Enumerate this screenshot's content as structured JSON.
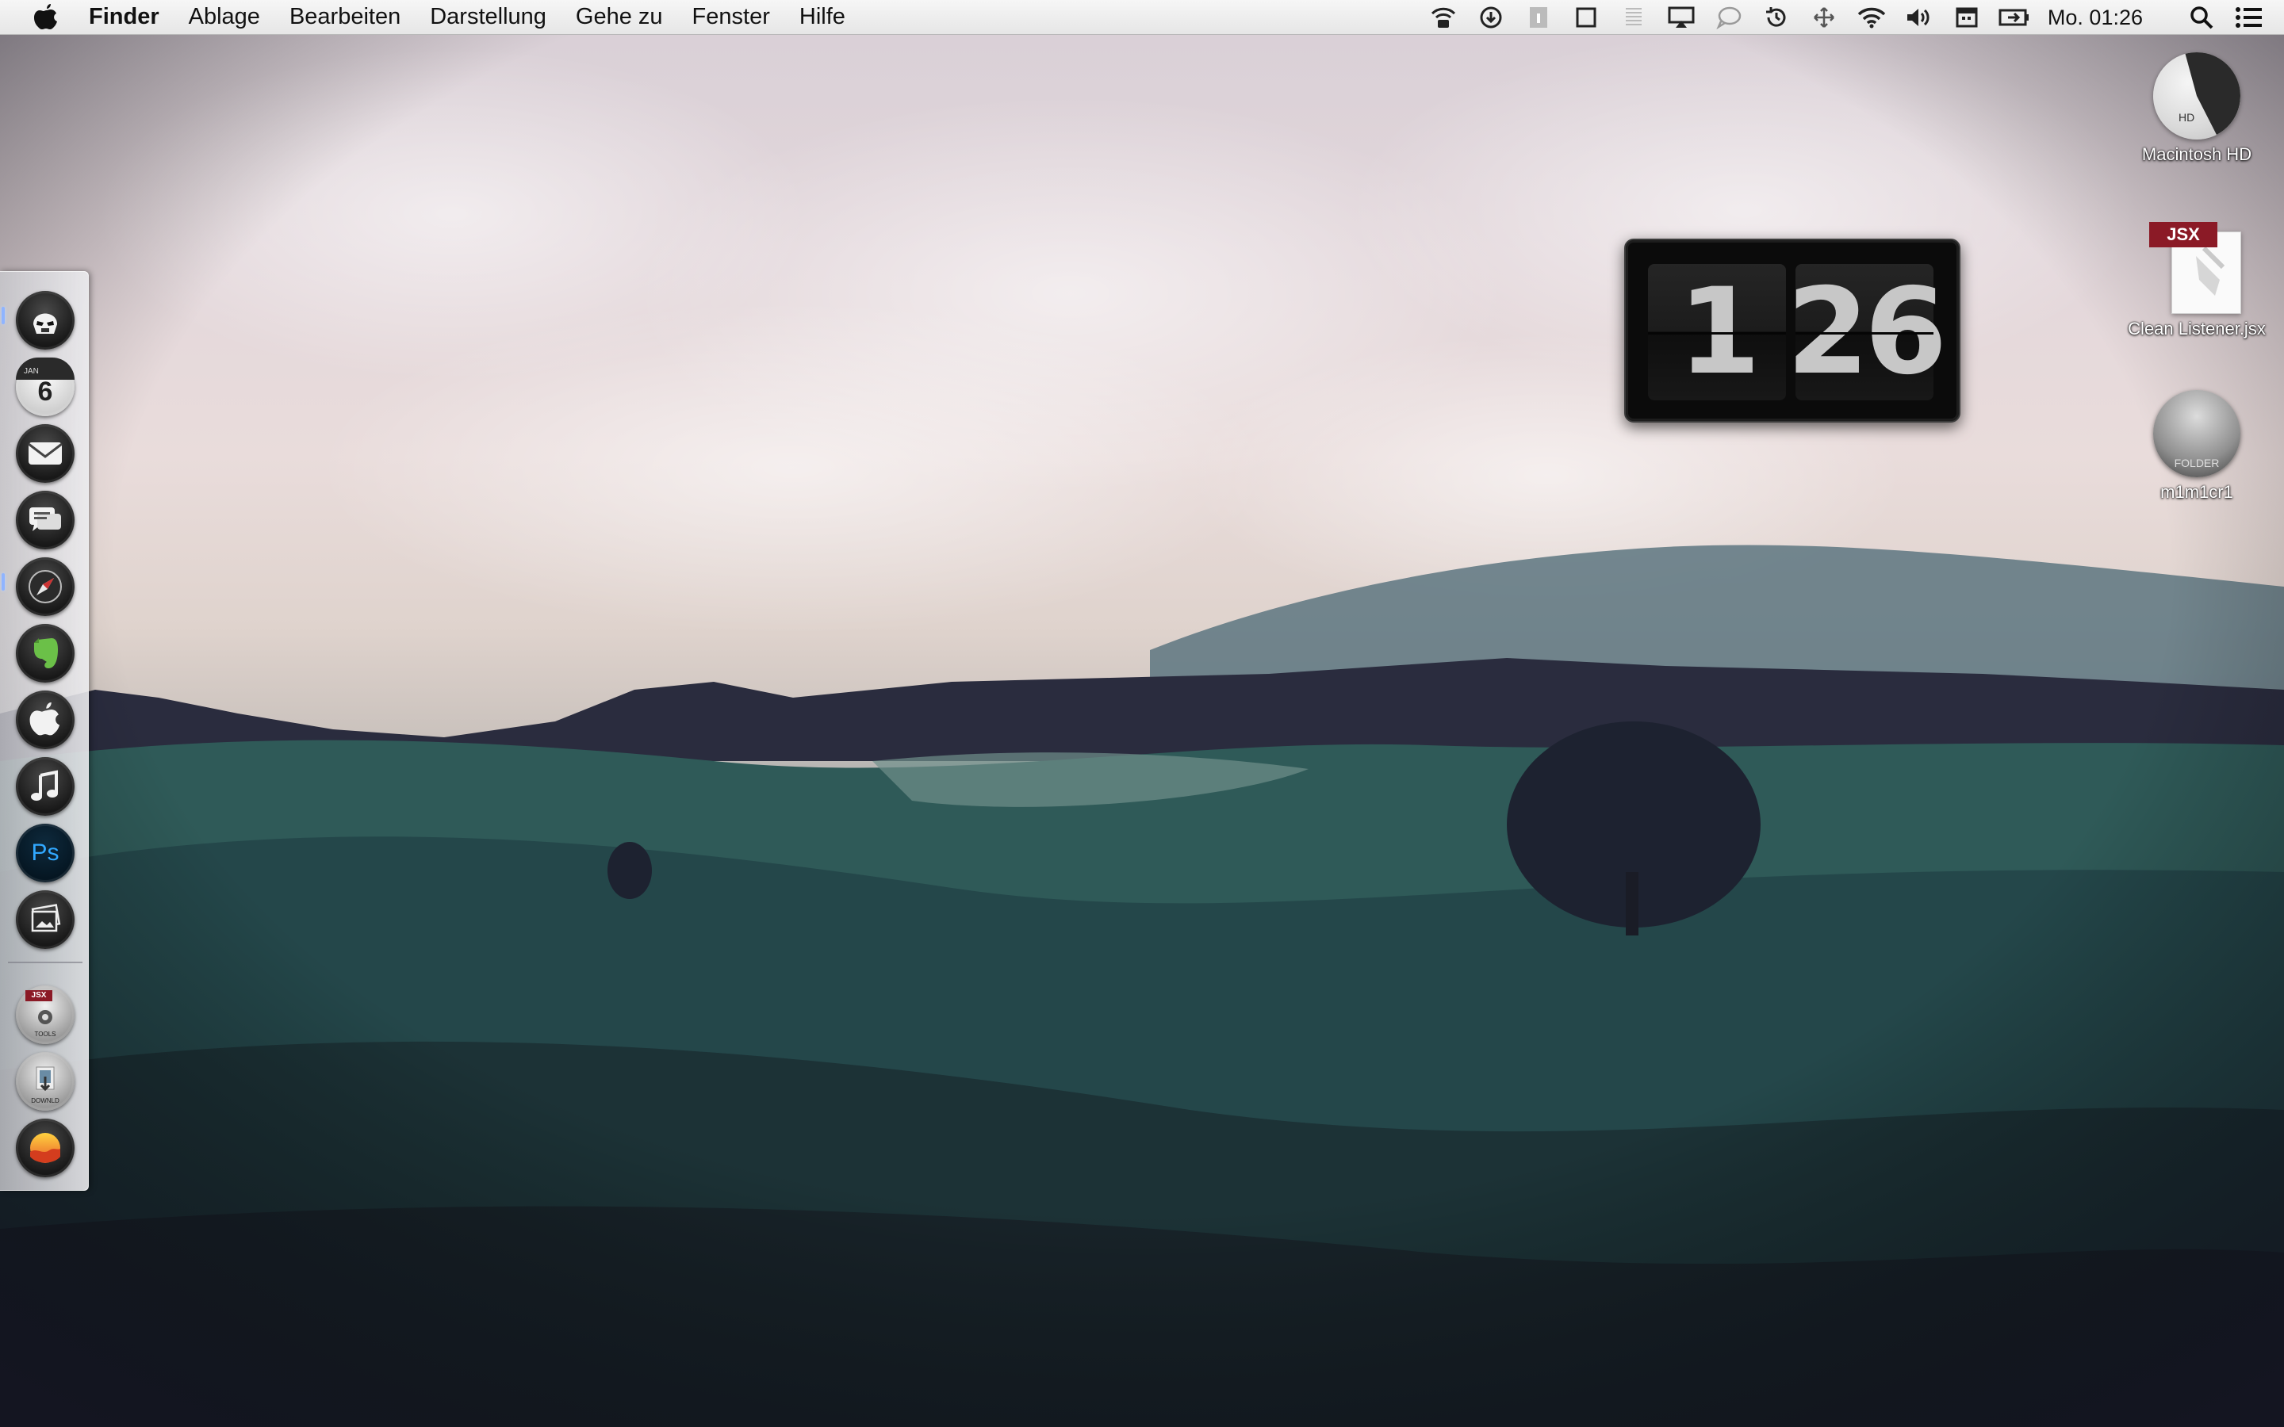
{
  "menubar": {
    "apple_icon": "apple-logo-icon",
    "menus": [
      "Finder",
      "Ablage",
      "Bearbeiten",
      "Darstellung",
      "Gehe zu",
      "Fenster",
      "Hilfe"
    ],
    "status_icons": [
      "wifi-broadcast-icon",
      "download-icon",
      "info-icon",
      "square-icon",
      "columns-icon",
      "airplay-icon",
      "chat-bubble-icon",
      "time-machine-icon",
      "move-icon",
      "wifi-icon",
      "volume-icon",
      "calendar-icon",
      "battery-icon"
    ],
    "clock": "Mo. 01:26",
    "search_icon": "spotlight-search-icon",
    "list_icon": "notification-center-icon"
  },
  "dock": {
    "apps": [
      {
        "icon": "stormtrooper-icon",
        "running": true
      },
      {
        "icon": "calendar-icon",
        "month": "JAN",
        "day": "6",
        "running": false
      },
      {
        "icon": "mail-icon",
        "running": false
      },
      {
        "icon": "messages-icon",
        "running": false
      },
      {
        "icon": "safari-compass-icon",
        "running": true
      },
      {
        "icon": "evernote-icon",
        "running": false
      },
      {
        "icon": "apple-icon",
        "running": false
      },
      {
        "icon": "itunes-music-icon",
        "running": false
      },
      {
        "icon": "photoshop-icon",
        "label": "Ps",
        "running": false
      },
      {
        "icon": "photos-icon",
        "running": false
      }
    ],
    "stacks": [
      {
        "icon": "tools-stack-icon",
        "badge": "JSX",
        "label": "TOOLS"
      },
      {
        "icon": "downloads-stack-icon",
        "label": "DOWNLD"
      },
      {
        "icon": "sunset-app-icon"
      }
    ]
  },
  "flipclock": {
    "hour": "1",
    "minute": "26"
  },
  "desktop": {
    "items": [
      {
        "label": "Macintosh HD",
        "tag": "HD"
      },
      {
        "label": "Clean Listener.jsx",
        "badge": "JSX"
      },
      {
        "label": "m1m1cr1",
        "tag": "FOLDER"
      }
    ]
  }
}
